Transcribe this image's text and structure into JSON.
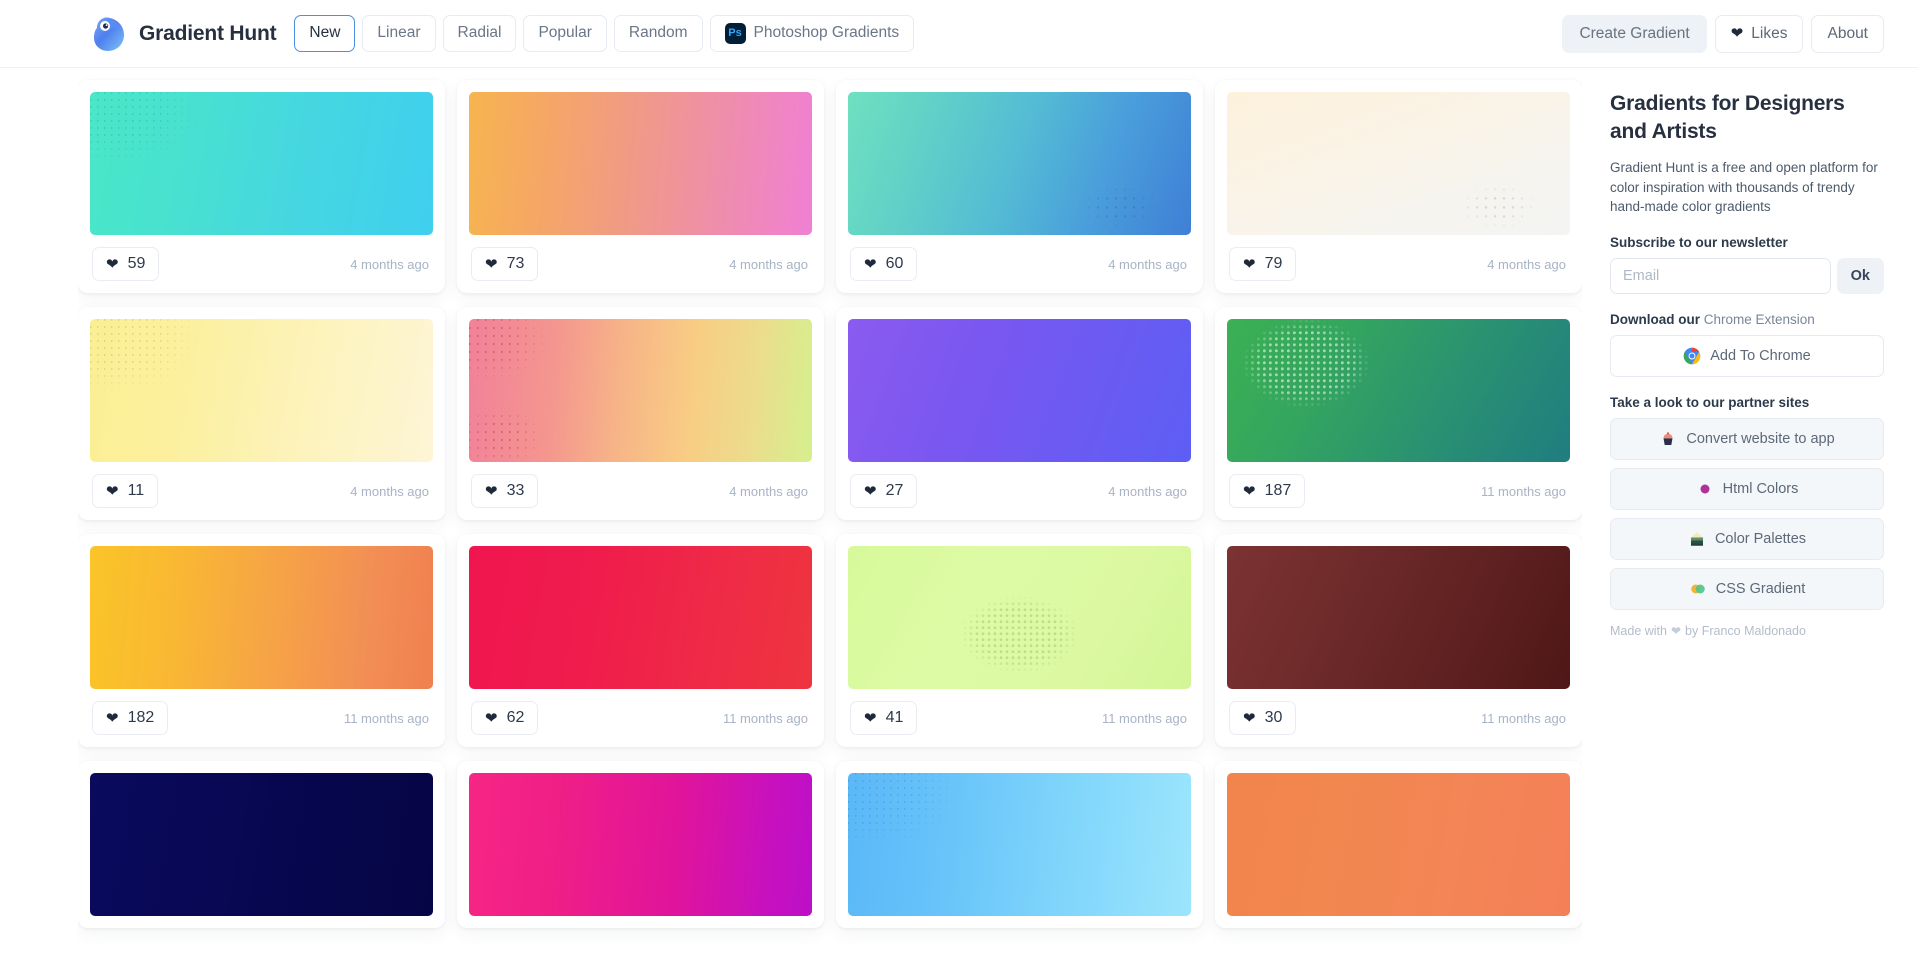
{
  "header": {
    "brand": "Gradient Hunt",
    "logo_icon": "bird-logo-icon",
    "nav": [
      {
        "label": "New",
        "active": true
      },
      {
        "label": "Linear",
        "active": false
      },
      {
        "label": "Radial",
        "active": false
      },
      {
        "label": "Popular",
        "active": false
      },
      {
        "label": "Random",
        "active": false
      },
      {
        "label": "Photoshop Gradients",
        "active": false,
        "badge": "Ps"
      }
    ],
    "create_gradient": "Create Gradient",
    "likes": "Likes",
    "likes_icon": "heart-icon",
    "about": "About"
  },
  "sidebar": {
    "title": "Gradients for Designers and Artists",
    "description": "Gradient Hunt is a free and open platform for color inspiration with thousands of trendy hand-made color gradients",
    "newsletter_label": "Subscribe to our newsletter",
    "email_placeholder": "Email",
    "email_value": "",
    "ok_label": "Ok",
    "download_label": "Download our",
    "download_link": "Chrome Extension",
    "chrome_button": "Add To Chrome",
    "chrome_icon": "chrome-icon",
    "partners_label": "Take a look to our partner sites",
    "partners": [
      {
        "label": "Convert website to app",
        "icon": "cupcake-icon"
      },
      {
        "label": "Html Colors",
        "icon": "purple-dot-icon"
      },
      {
        "label": "Color Palettes",
        "icon": "palette-house-icon"
      },
      {
        "label": "CSS Gradient",
        "icon": "two-circles-icon"
      }
    ],
    "made_with_prefix": "Made with",
    "made_with_icon": "heart-icon",
    "made_with_suffix": "by Franco Maldonado"
  },
  "gradients": [
    {
      "likes": "59",
      "time": "4 months ago",
      "css": "linear-gradient(100deg, #4ae7c8 0%, #48e2cf 25%, #45d7e0 60%, #3fd0ef 100%)",
      "texture": "tl"
    },
    {
      "likes": "73",
      "time": "4 months ago",
      "css": "linear-gradient(95deg, #f7b44f 0%, #f5a765 22%, #f09a87 48%, #ef8fa7 70%, #f07fd4 100%)",
      "texture": "none"
    },
    {
      "likes": "60",
      "time": "4 months ago",
      "css": "linear-gradient(110deg, #6fe0c0 0%, #62d3c6 20%, #54bcd4 48%, #4a9fdb 72%, #3f7fd6 100%)",
      "texture": "br"
    },
    {
      "likes": "79",
      "time": "4 months ago",
      "css": "linear-gradient(160deg, #fdf1dc 0%, #faf3e6 38%, #f6f4ef 72%, #f3f4f3 100%)",
      "texture": "br"
    },
    {
      "likes": "11",
      "time": "4 months ago",
      "css": "linear-gradient(100deg, #fbef93 0%, #fcf0a0 30%, #fdf3bd 65%, #fdf5d6 100%)",
      "texture": "tl"
    },
    {
      "likes": "33",
      "time": "4 months ago",
      "css": "linear-gradient(95deg, #f18199 0%, #f4968f 25%, #f7b587 45%, #f8cd84 65%, #ecdc8c 82%, #d5f08e 100%)",
      "texture": "tl-bl"
    },
    {
      "likes": "27",
      "time": "4 months ago",
      "css": "linear-gradient(110deg, #8a5bf0 0%, #7a57f0 35%, #6a5bf2 70%, #5d5ef4 100%)",
      "texture": "none"
    },
    {
      "likes": "187",
      "time": "11 months ago",
      "css": "linear-gradient(120deg, #3cb054 0%, #34a55f 30%, #2b9370 60%, #1f7d80 100%)",
      "texture": "blob"
    },
    {
      "likes": "182",
      "time": "11 months ago",
      "css": "linear-gradient(95deg, #fbc428 0%, #f9b833 25%, #f6a247 55%, #f28f55 80%, #f08050 100%)",
      "texture": "none"
    },
    {
      "likes": "62",
      "time": "11 months ago",
      "css": "linear-gradient(100deg, #f0154f 0%, #ef1c4c 35%, #ef2a46 70%, #ee353f 100%)",
      "texture": "none"
    },
    {
      "likes": "41",
      "time": "11 months ago",
      "css": "linear-gradient(120deg, #d7f99a 0%, #ddfba4 35%, #dcf9a2 70%, #d3f596 100%)",
      "texture": "blob-c"
    },
    {
      "likes": "30",
      "time": "11 months ago",
      "css": "linear-gradient(115deg, #7c3232 0%, #6e2a2a 35%, #5e2020 70%, #4e1717 100%)",
      "texture": "none"
    },
    {
      "likes": "",
      "time": "",
      "css": "linear-gradient(100deg, #0a0a5e 0%, #080855 35%, #06064c 70%, #050546 100%)",
      "texture": "none"
    },
    {
      "likes": "",
      "time": "",
      "css": "linear-gradient(95deg, #f72585 0%, #f01f86 25%, #e0149b 60%, #c811bd 85%, #bd0fc9 100%)",
      "texture": "none"
    },
    {
      "likes": "",
      "time": "",
      "css": "linear-gradient(95deg, #5bb8f8 0%, #68c4f9 30%, #81d6fb 65%, #9ce5fd 100%)",
      "texture": "tl"
    },
    {
      "likes": "",
      "time": "",
      "css": "linear-gradient(100deg, #f2844e 0%, #f2874f 30%, #f38556 65%, #f48058 100%)",
      "texture": "none"
    }
  ]
}
